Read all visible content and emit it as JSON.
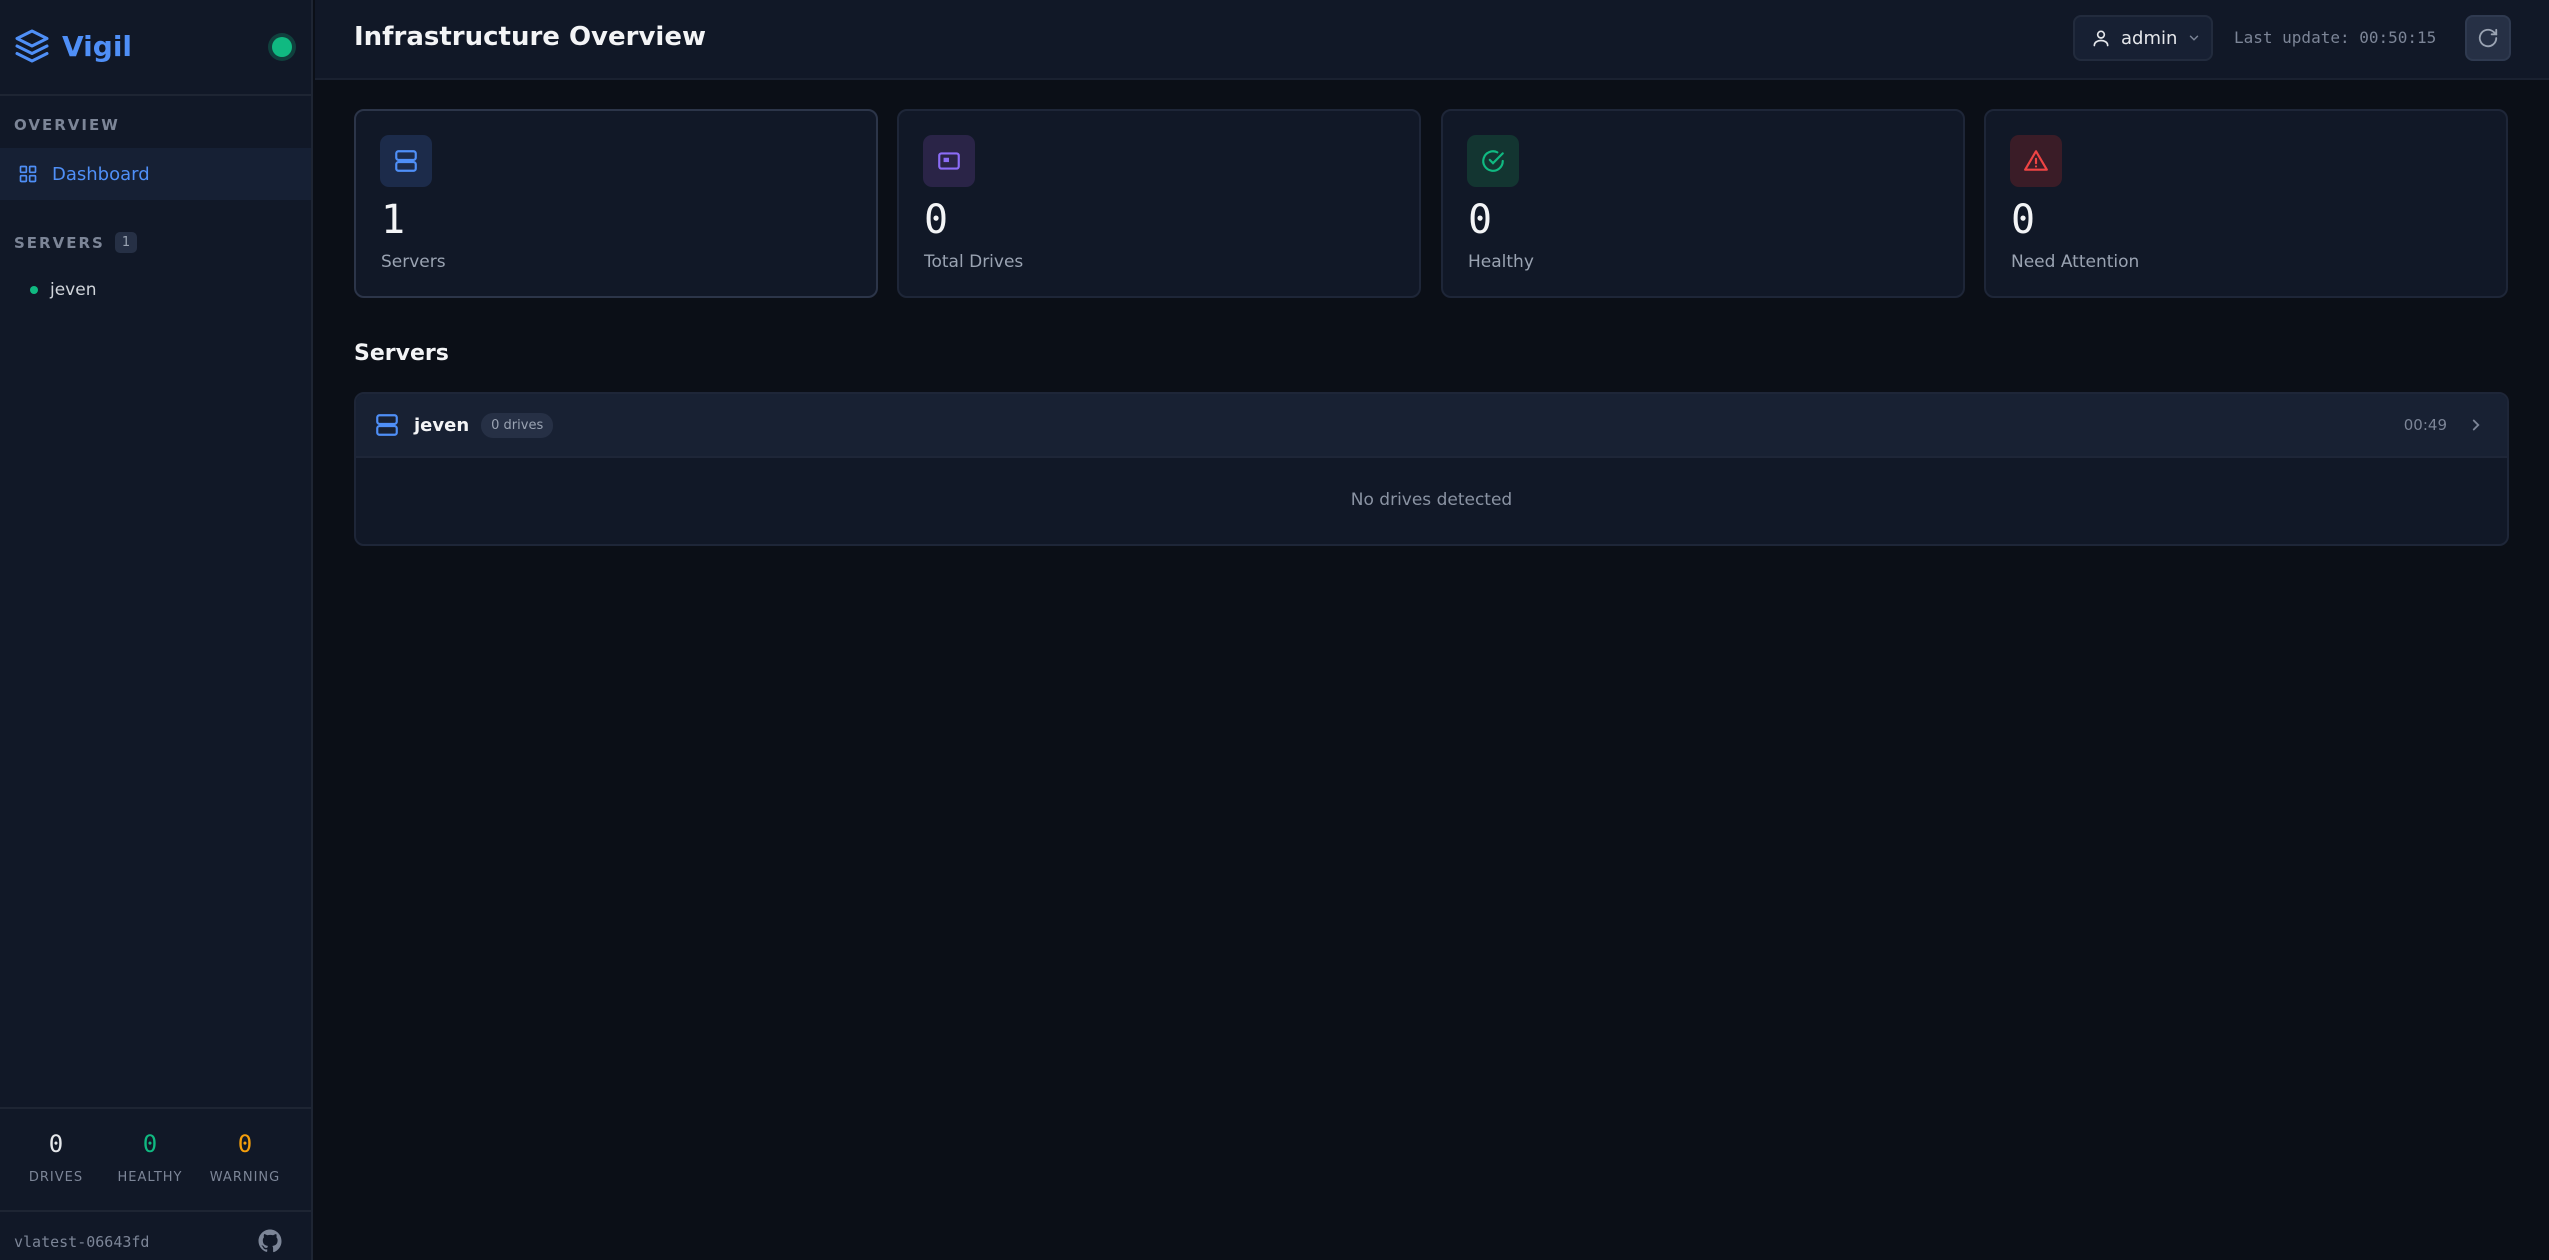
{
  "app": {
    "name": "Vigil",
    "accent": "#4f8ff7",
    "status_color": "#10b981"
  },
  "sidebar": {
    "overview_label": "OVERVIEW",
    "nav": [
      {
        "label": "Dashboard",
        "icon": "grid-icon",
        "active": true
      }
    ],
    "servers_label": "SERVERS",
    "servers_count": "1",
    "servers": [
      {
        "name": "jeven",
        "status": "online"
      }
    ],
    "stats": [
      {
        "value": "0",
        "label": "DRIVES",
        "color": "#e5e7eb"
      },
      {
        "value": "0",
        "label": "HEALTHY",
        "color": "#10b981"
      },
      {
        "value": "0",
        "label": "WARNING",
        "color": "#f59e0b"
      }
    ],
    "version": "vlatest-06643fd"
  },
  "header": {
    "title": "Infrastructure Overview",
    "user": "admin",
    "last_update": "Last update: 00:50:15"
  },
  "stats": [
    {
      "value": "1",
      "label": "Servers",
      "icon": "server-icon",
      "color": "#4f8ff7",
      "bg": "#1c2b4a"
    },
    {
      "value": "0",
      "label": "Total Drives",
      "icon": "drive-icon",
      "color": "#8b6cf6",
      "bg": "#2a2447"
    },
    {
      "value": "0",
      "label": "Healthy",
      "icon": "check-circle-icon",
      "color": "#10b981",
      "bg": "#133531"
    },
    {
      "value": "0",
      "label": "Need Attention",
      "icon": "warning-icon",
      "color": "#ef4444",
      "bg": "#3a1c27"
    }
  ],
  "servers_section": {
    "heading": "Servers",
    "items": [
      {
        "name": "jeven",
        "drives_badge": "0 drives",
        "time": "00:49",
        "empty_text": "No drives detected"
      }
    ]
  }
}
